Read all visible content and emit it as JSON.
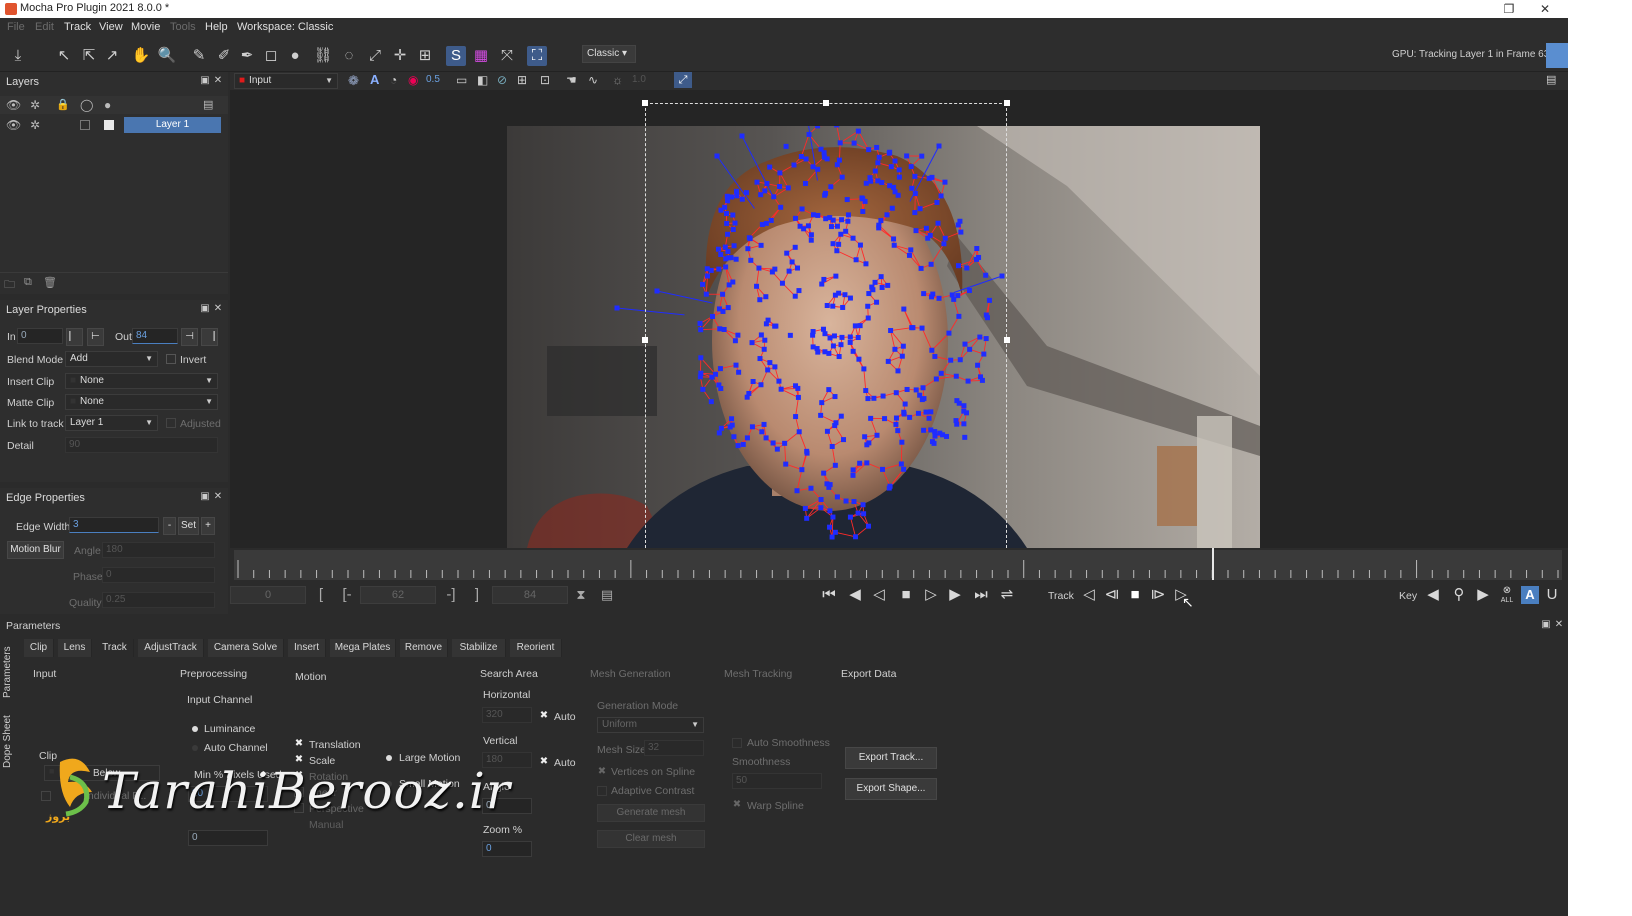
{
  "window": {
    "title": "Mocha Pro Plugin 2021 8.0.0 *"
  },
  "menu": [
    "File",
    "Edit",
    "Track",
    "View",
    "Movie",
    "Tools",
    "Help",
    "Workspace: Classic"
  ],
  "toolbar": {
    "workspace": "Classic",
    "gpu_status": "GPU: Tracking Layer 1 in Frame 63",
    "progress_label": "100%",
    "progress_fraction": 1.0
  },
  "viewer_toolbar": {
    "view_source": "Input",
    "opacity": "0.5",
    "gamma": "1.0"
  },
  "layers": {
    "title": "Layers",
    "items": [
      {
        "name": "Layer 1",
        "color": "#e8e8e8"
      }
    ]
  },
  "layer_properties": {
    "title": "Layer Properties",
    "in_label": "In",
    "in_value": "0",
    "out_label": "Out",
    "out_value": "84",
    "blend_mode_label": "Blend Mode",
    "blend_mode": "Add",
    "invert_label": "Invert",
    "insert_clip_label": "Insert Clip",
    "insert_clip": "None",
    "matte_clip_label": "Matte Clip",
    "matte_clip": "None",
    "link_to_track_label": "Link to track",
    "link_to_track": "Layer 1",
    "adjusted_label": "Adjusted",
    "detail_label": "Detail",
    "detail_value": "90"
  },
  "edge_properties": {
    "title": "Edge Properties",
    "edge_width_label": "Edge Width",
    "edge_width": "3",
    "minus": "-",
    "set": "Set",
    "plus": "+",
    "motion_blur": "Motion Blur",
    "angle_label": "Angle",
    "angle": "180",
    "phase_label": "Phase",
    "phase": "0",
    "quality_label": "Quality",
    "quality": "0.25"
  },
  "transport": {
    "start_frame": "0",
    "current_frame": "62",
    "end_frame": "84",
    "track_label": "Track",
    "key_label": "Key",
    "all_label": "ALL"
  },
  "parameters": {
    "title": "Parameters",
    "side_tabs": [
      "Parameters",
      "Dope Sheet"
    ],
    "tabs": [
      "Clip",
      "Lens",
      "Track",
      "AdjustTrack",
      "Camera Solve",
      "Insert",
      "Mega Plates",
      "Remove",
      "Stabilize",
      "Reorient"
    ],
    "active_tab": "Track",
    "input": {
      "title": "Input",
      "clip_label": "Clip",
      "below": "Below",
      "individual": "Individual F..."
    },
    "preprocessing": {
      "title": "Preprocessing",
      "input_channel": "Input Channel",
      "luminance": "Luminance",
      "auto_channel": "Auto Channel",
      "min_pixels": "Min % Pixels Used",
      "min_pixels_value": "20",
      "smoothing_value": "0"
    },
    "motion": {
      "title": "Motion",
      "translation": "Translation",
      "scale": "Scale",
      "rotation": "Rotation",
      "shear": "Shear",
      "perspective": "Perspective",
      "large_motion": "Large Motion",
      "small_motion": "Small Motion",
      "manual": "Manual"
    },
    "search_area": {
      "title": "Search Area",
      "horizontal": "Horizontal",
      "horizontal_value": "320",
      "vertical": "Vertical",
      "vertical_value": "180",
      "auto": "Auto",
      "angle": "Angle",
      "angle_value": "0",
      "zoom": "Zoom %",
      "zoom_value": "0"
    },
    "mesh_generation": {
      "title": "Mesh Generation",
      "generation_mode": "Generation Mode",
      "mode": "Uniform",
      "mesh_size": "Mesh Size",
      "mesh_size_value": "32",
      "vertices_on_spline": "Vertices on Spline",
      "adaptive_contrast": "Adaptive Contrast",
      "generate": "Generate mesh",
      "clear": "Clear mesh"
    },
    "mesh_tracking": {
      "title": "Mesh Tracking",
      "auto_smoothness": "Auto Smoothness",
      "smoothness": "Smoothness",
      "smoothness_value": "50",
      "warp_spline": "Warp Spline"
    },
    "export_data": {
      "title": "Export Data",
      "export_track": "Export Track...",
      "export_shape": "Export Shape..."
    }
  },
  "watermark": {
    "text": "TarahiBerooz.ir",
    "logo_text": "بروز"
  },
  "colors": {
    "accent": "#4e7fb8",
    "mesh_edge": "#ff2a2a",
    "mesh_vertex": "#1f2cff",
    "layer_swatch": "#e11b1b"
  }
}
